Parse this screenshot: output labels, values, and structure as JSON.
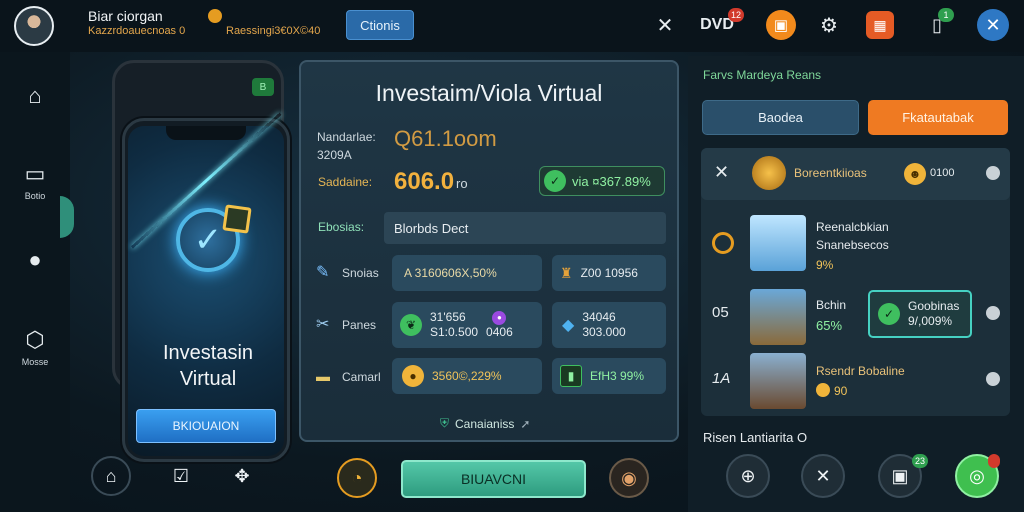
{
  "header": {
    "player_name": "Biar ciorgan",
    "player_stat_1": "Kazzrdoauecnoas 0",
    "player_stat_2": "Raessingi3€0X©40",
    "top_button_label": "Ctionis",
    "badge_counts": [
      "12",
      "1"
    ],
    "icons": [
      "close-icon",
      "sheep-icon",
      "chest-icon",
      "settings-icon",
      "gift-icon",
      "smartphone-icon",
      "close-circle-icon"
    ]
  },
  "sidebar": {
    "items": [
      {
        "icon": "camera-icon",
        "label": ""
      },
      {
        "icon": "monitor-icon",
        "label": "Botio"
      },
      {
        "icon": "record-icon",
        "label": ""
      },
      {
        "icon": "gear-icon",
        "label": "Mosse"
      }
    ]
  },
  "phone": {
    "title_line1": "Investasin",
    "title_line2": "Virtual",
    "button_label": "BKIOUAION",
    "battery_label": "B"
  },
  "panel": {
    "title": "Investaim/Viola Virtual",
    "row1_label": "Nandarlae:\n3209A",
    "row1_value": "Q61.1oom",
    "row2_label": "Saddaine:",
    "row2_value": "606.0",
    "row2_unit": "ro",
    "row2_pct": "via ¤367.89%",
    "field_label": "Ebosias:",
    "field_value": "Blorbds Dect",
    "rows": [
      {
        "label": "Snoias",
        "cell1": "A 3160606X,50%",
        "cell2": "Z00 10956"
      },
      {
        "label": "Panes",
        "cell1a": "31'656",
        "cell1b": "S1:0.500",
        "cell1c": "0406",
        "cell2a": "34046",
        "cell2b": "303.000"
      },
      {
        "label": "Camarl",
        "cell1": "3560©,229%",
        "cell2": "EfH3 99%"
      }
    ],
    "footer": "Canaianiss"
  },
  "bottom_center": {
    "button_label": "BIUAVCNI"
  },
  "right": {
    "title": "Farvs Mardeya Reans",
    "btn_left": "Baodea",
    "btn_right": "Fkatautabak",
    "list": [
      {
        "index": "",
        "name": "Boreentkiioas",
        "value": "0100"
      },
      {
        "index": "",
        "name": "Reenalcbkian",
        "sub": "Snanebsecos",
        "pct": "9%"
      },
      {
        "index": "05",
        "name": "Bchin",
        "pct": "65%",
        "sel_name": "Goobinas",
        "sel_pct": "9/,009%"
      },
      {
        "index": "1A",
        "name": "Rsendr Bobaline",
        "value": "90"
      }
    ],
    "footer": "Risen Lantiarita O",
    "bottom_badge": "23"
  },
  "colors": {
    "accent_orange": "#f28a1c",
    "accent_green": "#3fbf5f",
    "accent_teal": "#46d1c2",
    "panel_bg": "#1c2f3a"
  }
}
